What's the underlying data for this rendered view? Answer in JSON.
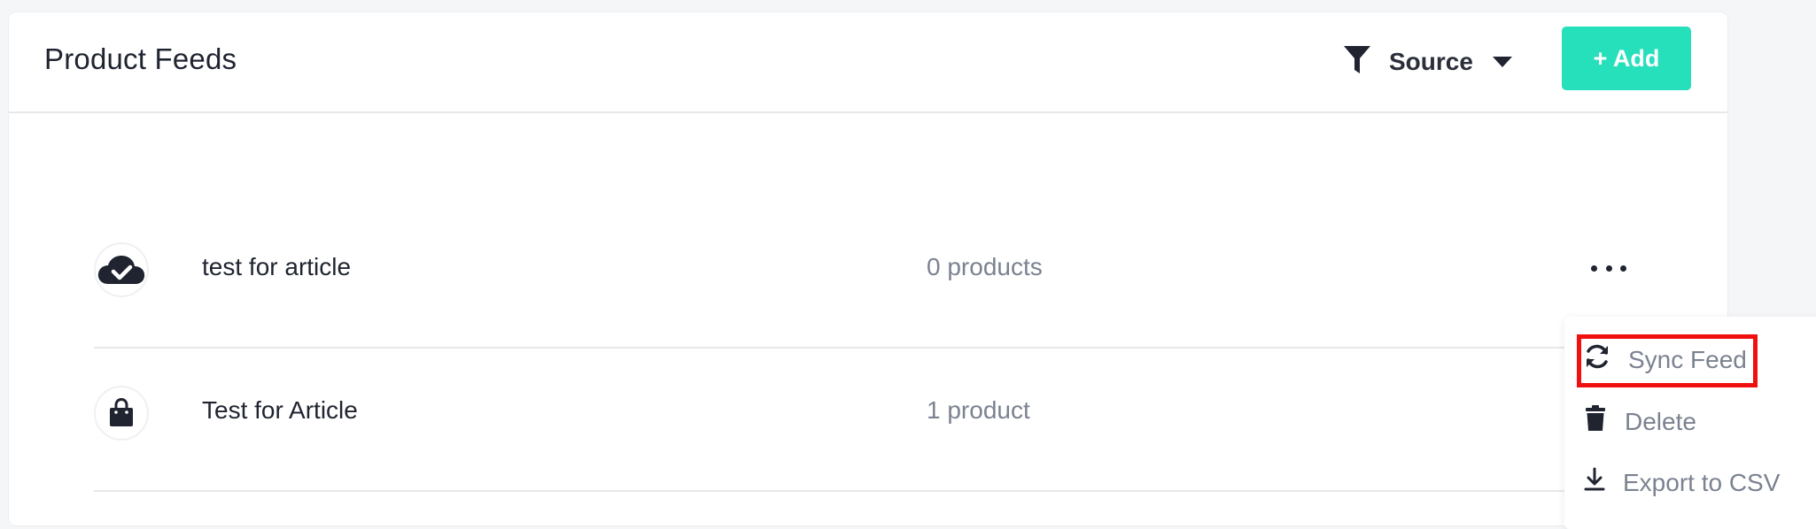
{
  "header": {
    "title": "Product Feeds",
    "filter_label": "Source",
    "add_label": "+ Add"
  },
  "feeds": [
    {
      "name": "test for article",
      "count": "0 products",
      "icon": "cloud-check-icon"
    },
    {
      "name": "Test for Article",
      "count": "1 product",
      "icon": "shopping-bag-icon"
    }
  ],
  "menu": {
    "items": [
      {
        "label": "Sync Feed",
        "icon": "sync-icon",
        "highlighted": true
      },
      {
        "label": "Delete",
        "icon": "trash-icon"
      },
      {
        "label": "Export to CSV",
        "icon": "download-icon"
      }
    ]
  },
  "colors": {
    "accent": "#26e0bc",
    "highlight": "#f01010",
    "text_muted": "#7b8290"
  }
}
